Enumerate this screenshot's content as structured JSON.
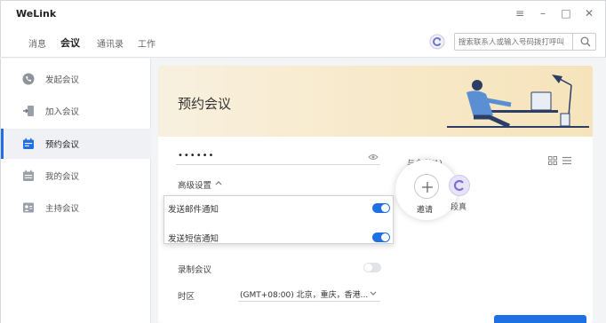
{
  "app": {
    "title": "WeLink"
  },
  "window_controls": {
    "menu": "≡",
    "minimize": "–",
    "maximize": "□",
    "close": "✕"
  },
  "nav": {
    "tabs": [
      {
        "label": "消息",
        "active": false
      },
      {
        "label": "会议",
        "active": true
      },
      {
        "label": "通讯录",
        "active": false
      },
      {
        "label": "工作",
        "active": false
      }
    ],
    "search_placeholder": "搜索联系人或输入号码拨打呼叫"
  },
  "sidebar": {
    "items": [
      {
        "label": "发起会议",
        "icon": "phone-icon",
        "active": false
      },
      {
        "label": "加入会议",
        "icon": "join-icon",
        "active": false
      },
      {
        "label": "预约会议",
        "icon": "calendar-icon",
        "active": true
      },
      {
        "label": "我的会议",
        "icon": "calendar-list-icon",
        "active": false
      },
      {
        "label": "主持会议",
        "icon": "host-icon",
        "active": false
      }
    ]
  },
  "form": {
    "banner_title": "预约会议",
    "password_value": "••••••",
    "advanced_settings_label": "高级设置",
    "notifications": [
      {
        "label": "发送邮件通知",
        "enabled": true
      },
      {
        "label": "发送短信通知",
        "enabled": true
      }
    ],
    "record_label": "录制会议",
    "record_enabled": false,
    "timezone_label": "时区",
    "timezone_value": "(GMT+08:00) 北京，重庆，香港..."
  },
  "participants": {
    "label": "与会者(1)",
    "invite_label": "邀请",
    "members": [
      {
        "name": "段真"
      }
    ]
  },
  "colors": {
    "accent": "#1f6fe5",
    "banner": "#f7e8c6"
  }
}
